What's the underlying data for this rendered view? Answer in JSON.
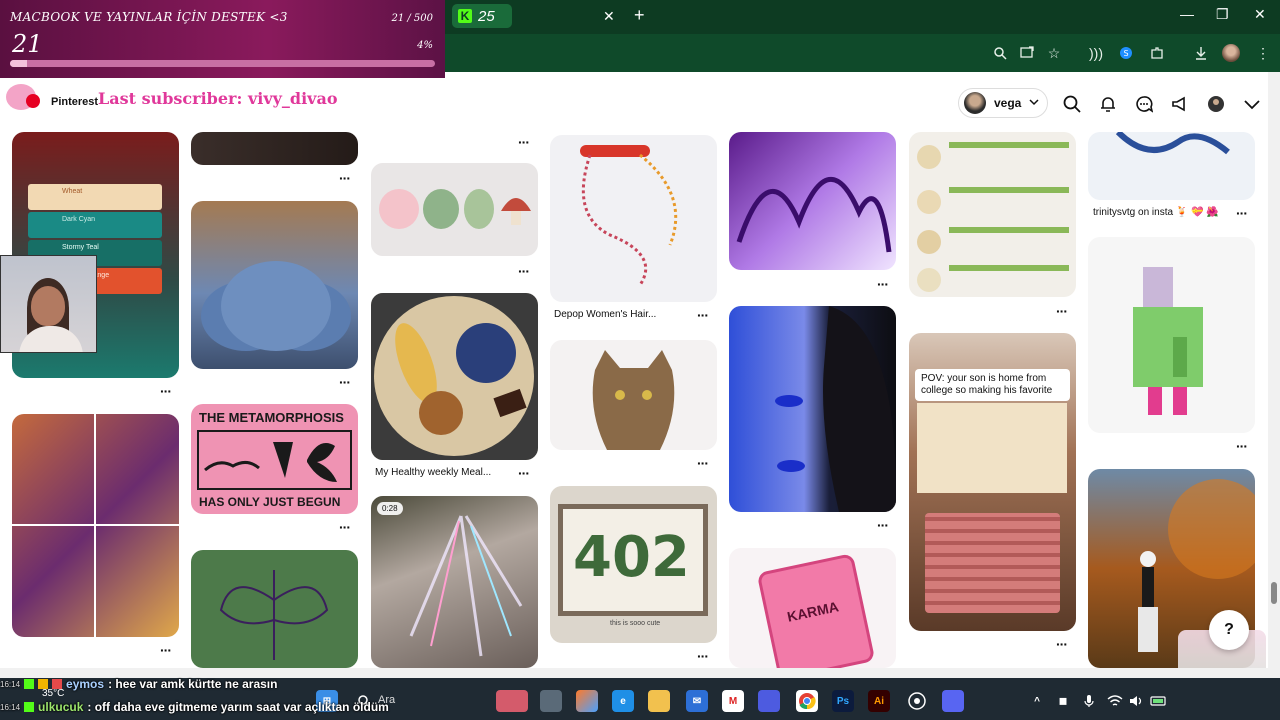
{
  "donation": {
    "title": "MACBOOK VE YAYINLAR İÇİN DESTEK <3",
    "count": "21 / 500",
    "amount": "21",
    "percent": "4%",
    "progress": 0.04
  },
  "browser": {
    "kick_tab_count": "25",
    "close_glyph": "✕",
    "new_tab_glyph": "+",
    "minimize_glyph": "—",
    "maximize_glyph": "❐",
    "window_close_glyph": "✕"
  },
  "header": {
    "pinterest_label": "Pinterest",
    "subscriber_text": "Last subscriber: vivy_divao",
    "account_name": "vega"
  },
  "pins": {
    "tile_1": {
      "title": "Wheat",
      "rows": [
        "Wheat",
        "Dark Cyan",
        "Stormy Teal",
        "Sunset Orange"
      ]
    },
    "metamorphosis_top": "THE METAMORPHOSIS",
    "metamorphosis_bottom": "HAS ONLY JUST BEGUN",
    "depop_caption": "Depop Women's Hair...",
    "meal_caption": "My Healthy weekly Meal...",
    "video_badge": "0:28",
    "mosaic_number": "402",
    "mosaic_note": "this is sooo cute",
    "karma_text": "KARMA",
    "pov_text": "POV: your son is home from college so making his favorite",
    "trinity_caption": "trinitysvtg on insta 🍹 💝 🌺",
    "more_glyph": "···"
  },
  "chat": [
    {
      "time": "16:14",
      "user": "eymos",
      "message": ": hee var amk kürtte ne arasın",
      "color": "#a9d0ff"
    },
    {
      "time": "16:14",
      "user": "ulkucuk",
      "message": ": off daha eve gitmeme yarım saat var açlıktan öldüm",
      "color": "#9be36b"
    }
  ],
  "taskbar": {
    "temperature": "35°C",
    "search_placeholder": "Ara"
  },
  "help_glyph": "?",
  "colors": {
    "chrome_dark": "#0d3b22",
    "chrome": "#0f4a2a",
    "pinterest_red": "#e60023",
    "donation_bg": "#8a1a5c",
    "subscriber_pink": "#e0389a"
  }
}
